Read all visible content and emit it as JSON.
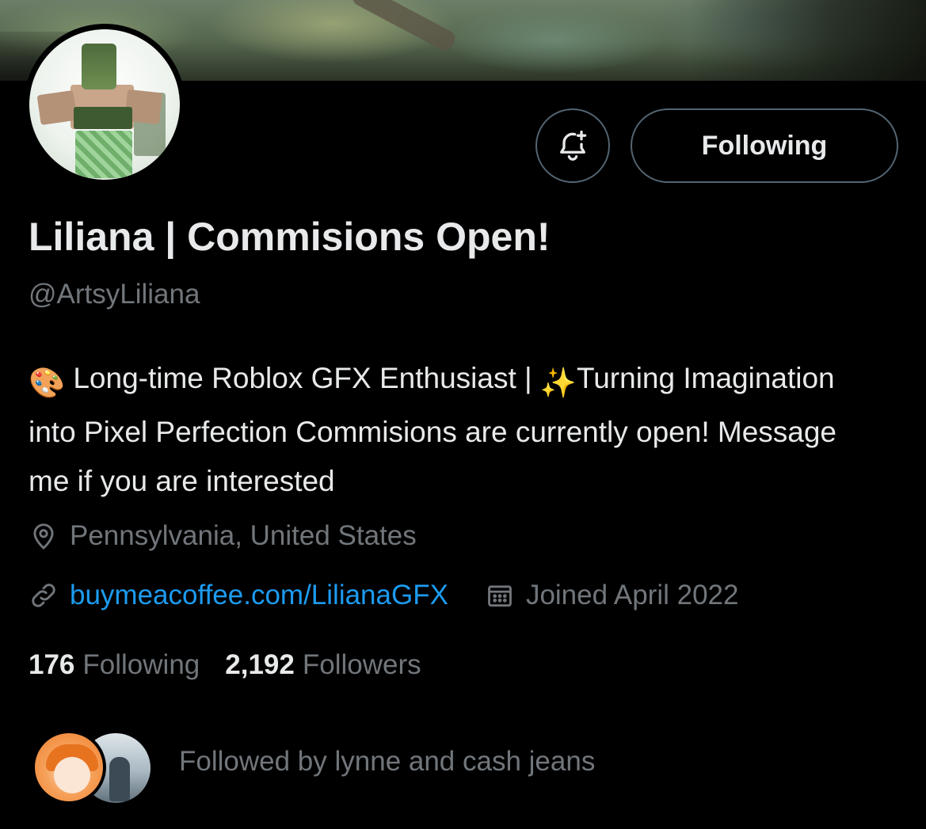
{
  "profile": {
    "display_name": "Liliana | Commisions Open!",
    "handle": "@ArtsyLiliana",
    "bio_emoji_1": "🎨",
    "bio_part_1": " Long-time Roblox GFX Enthusiast | ",
    "bio_emoji_2": "✨",
    "bio_part_2": "Turning Imagination into Pixel Perfection Commisions are currently open! Message me if you are interested",
    "location": "Pennsylvania, United States",
    "website": "buymeacoffee.com/LilianaGFX",
    "joined": "Joined April 2022"
  },
  "actions": {
    "following_label": "Following",
    "notify_icon": "bell-plus-icon"
  },
  "stats": {
    "following_count": "176",
    "following_label": "Following",
    "followers_count": "2,192",
    "followers_label": "Followers"
  },
  "followed_by": {
    "text": "Followed by lynne and cash jeans"
  },
  "icons": {
    "location": "location-pin-icon",
    "link": "link-icon",
    "calendar": "calendar-icon"
  },
  "colors": {
    "background": "#000000",
    "primary_text": "#e7e9ea",
    "secondary_text": "#71767b",
    "link": "#1d9bf0",
    "border": "#536471"
  }
}
